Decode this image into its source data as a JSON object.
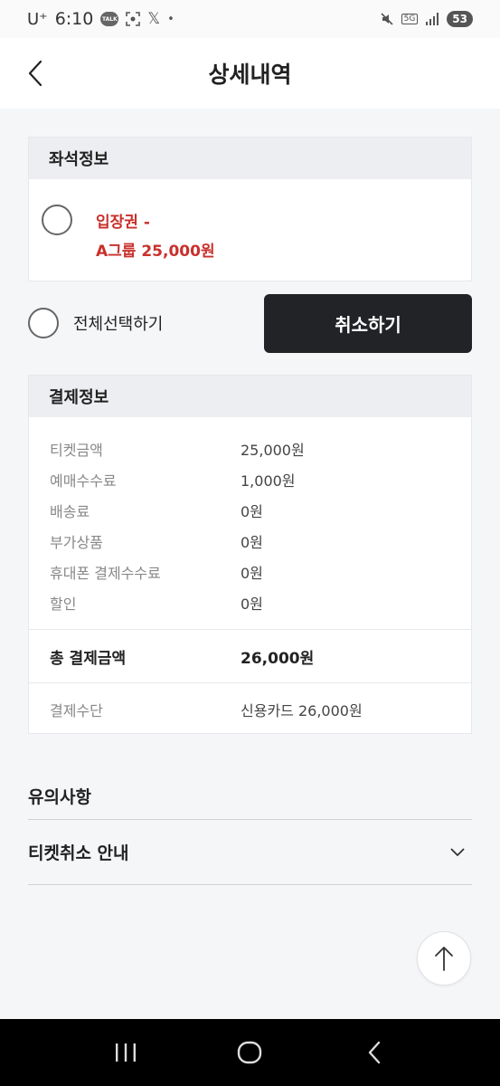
{
  "status_bar": {
    "carrier": "U⁺",
    "time": "6:10",
    "talk_badge": "TALK",
    "x_glyph": "𝕏",
    "dot": "•",
    "network": "5G",
    "battery": "53"
  },
  "header": {
    "title": "상세내역"
  },
  "seat_info": {
    "heading": "좌석정보",
    "ticket_line1": "입장권 -",
    "ticket_line2": "A그룹 25,000원"
  },
  "select_all_label": "전체선택하기",
  "cancel_button": "취소하기",
  "payment": {
    "heading": "결제정보",
    "rows": [
      {
        "label": "티켓금액",
        "value": "25,000원"
      },
      {
        "label": "예매수수료",
        "value": "1,000원"
      },
      {
        "label": "배송료",
        "value": "0원"
      },
      {
        "label": "부가상품",
        "value": "0원"
      },
      {
        "label": "휴대폰 결제수수료",
        "value": "0원"
      },
      {
        "label": "할인",
        "value": "0원"
      }
    ],
    "total_label": "총 결제금액",
    "total_value": "26,000원",
    "method_label": "결제수단",
    "method_value": "신용카드 26,000원"
  },
  "notice": {
    "title": "유의사항",
    "accordion_label": "티켓취소 안내"
  },
  "colors": {
    "accent_red": "#c9302c",
    "dark_button": "#222327"
  }
}
